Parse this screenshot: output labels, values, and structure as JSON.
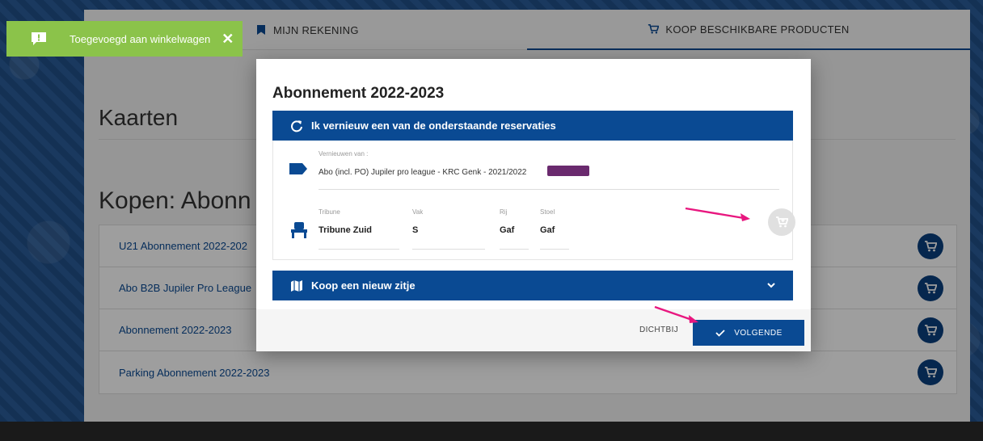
{
  "toast": {
    "message": "Toegevoegd aan winkelwagen",
    "close_glyph": "✕",
    "icon": "alert-icon",
    "color": "#8bc34a"
  },
  "topnav": {
    "account_label": "MIJN REKENING",
    "shop_label": "KOOP BESCHIKBARE PRODUCTEN"
  },
  "page": {
    "cards_heading": "Kaarten",
    "buy_heading": "Kopen: Abonn",
    "products": [
      {
        "label": "U21 Abonnement 2022-202"
      },
      {
        "label": "Abo B2B Jupiler Pro League"
      },
      {
        "label": "Abonnement 2022-2023"
      },
      {
        "label": "Parking Abonnement 2022-2023"
      }
    ]
  },
  "modal": {
    "title": "Abonnement 2022-2023",
    "renew_section": {
      "title": "Ik vernieuw een van de onderstaande reservaties",
      "renew_from_label": "Vernieuwen van :",
      "renew_from_value": "Abo (incl. PO) Jupiler pro league - KRC Genk - 2021/2022",
      "fields": [
        {
          "label": "Tribune",
          "value": "Tribune Zuid"
        },
        {
          "label": "Vak",
          "value": "S"
        },
        {
          "label": "Rij",
          "value": "Gaf"
        },
        {
          "label": "Stoel",
          "value": "Gaf"
        }
      ]
    },
    "new_seat_section": {
      "title": "Koop een nieuw zitje"
    },
    "footer": {
      "close_label": "DICHTBIJ",
      "next_label": "VOLGENDE"
    }
  },
  "colors": {
    "primary": "#0a4a93",
    "accent_arrow": "#e8177f",
    "toast": "#8bc34a"
  }
}
